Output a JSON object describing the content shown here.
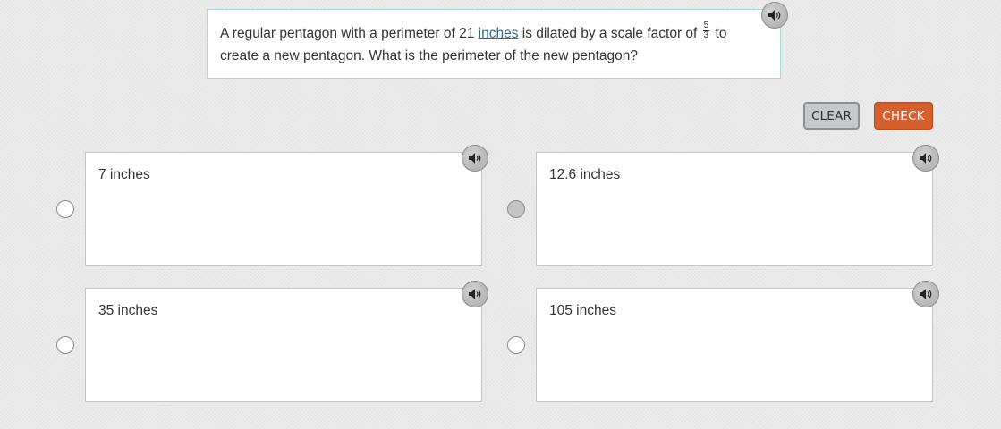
{
  "question": {
    "text_before_link": "A regular pentagon with a perimeter of 21 ",
    "link_text": "inches",
    "text_after_link": " is dilated by a scale factor of ",
    "fraction_numerator": "5",
    "fraction_denominator": "3",
    "text_end": " to create a new pentagon. What is the perimeter of the new pentagon?"
  },
  "buttons": {
    "clear": "CLEAR",
    "check": "CHECK"
  },
  "options": [
    {
      "label": "7 inches",
      "selected": false
    },
    {
      "label": "12.6 inches",
      "selected": true
    },
    {
      "label": "35 inches",
      "selected": false
    },
    {
      "label": "105 inches",
      "selected": false
    }
  ],
  "icons": {
    "audio": "speaker-icon"
  },
  "colors": {
    "check_button": "#d5602e",
    "link": "#2b6b8f",
    "question_border": "#a9d6df"
  }
}
